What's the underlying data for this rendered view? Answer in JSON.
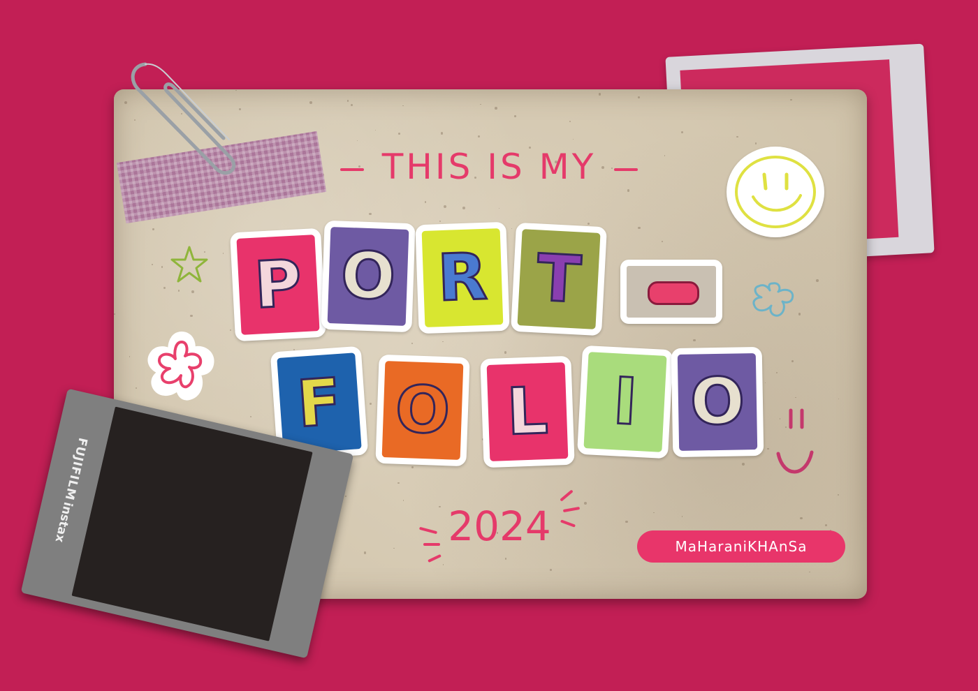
{
  "header": {
    "text": "THIS IS MY"
  },
  "title": {
    "row1": [
      {
        "char": "P",
        "tile_color": "#e8336b",
        "letter_color": "#f4d7dc"
      },
      {
        "char": "O",
        "tile_color": "#6e5aa3",
        "letter_color": "#e7e0cf"
      },
      {
        "char": "R",
        "tile_color": "#d8e630",
        "letter_color": "#4a7ad0"
      },
      {
        "char": "T",
        "tile_color": "#9ba448",
        "letter_color": "#8a3fb0"
      }
    ],
    "dash": "-",
    "row2": [
      {
        "char": "F",
        "tile_color": "#1e62ad",
        "letter_color": "#e3d84a"
      },
      {
        "char": "O",
        "tile_color": "#e96a25",
        "letter_color": "#e96a25"
      },
      {
        "char": "L",
        "tile_color": "#e8336b",
        "letter_color": "#f4d7dc"
      },
      {
        "char": "I",
        "tile_color": "#a9dc7c",
        "letter_color": "#a9dc7c"
      },
      {
        "char": "O",
        "tile_color": "#6e5aa3",
        "letter_color": "#e7e0cf"
      }
    ]
  },
  "year": "2024",
  "author": "MaHaraniKHAnSa",
  "instax": {
    "brand": "FUJIFILM",
    "product": "instax"
  },
  "colors": {
    "background": "#c21f55",
    "accent": "#e53a6a",
    "card": "#d7cbb3"
  }
}
